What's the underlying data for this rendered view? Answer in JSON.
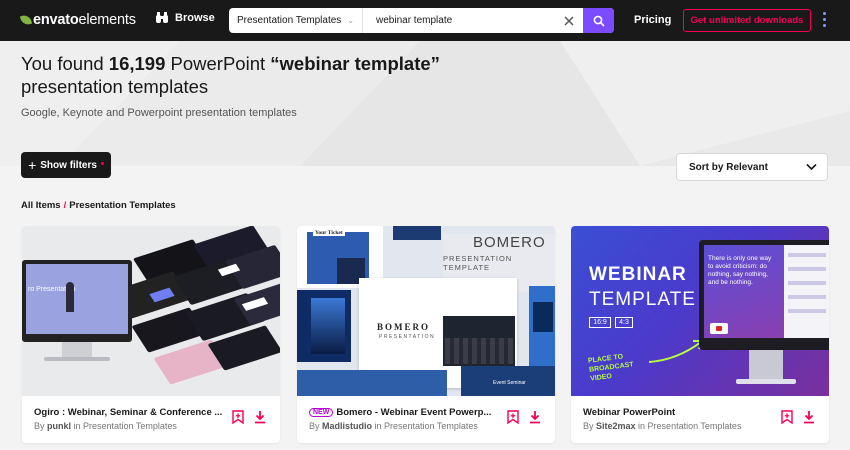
{
  "nav": {
    "logo_bold": "envato",
    "logo_light": "elements",
    "browse_label": "Browse",
    "search_category": "Presentation Templates",
    "search_value": "webinar template",
    "pricing_label": "Pricing",
    "cta_label": "Get unlimited downloads",
    "colors": {
      "bar": "#191919",
      "search_button": "#7b4bff",
      "cta": "#f50057",
      "logo_leaf": "#82b541"
    }
  },
  "hero": {
    "prefix": "You found ",
    "count": "16,199",
    "middle": " PowerPoint ",
    "query": "“webinar template”",
    "suffix": "presentation templates",
    "subtitle": "Google, Keynote and Powerpoint presentation templates"
  },
  "filters": {
    "show_filters_label": "Show filters",
    "sort_label": "Sort by Relevant"
  },
  "breadcrumb": {
    "root": "All Items",
    "separator": "/",
    "current": "Presentation Templates"
  },
  "cards": [
    {
      "title": "Ogiro : Webinar, Seminar & Conference ...",
      "by_prefix": "By ",
      "author": "punkl",
      "in_text": " in Presentation Templates",
      "is_new": false,
      "thumb_text": "ro Presentation"
    },
    {
      "title": "Bomero - Webinar Event Powerp...",
      "by_prefix": "By ",
      "author": "Madlistudio",
      "in_text": " in Presentation Templates",
      "is_new": true,
      "new_label": "NEW",
      "thumb_title": "BOMERO",
      "thumb_subtitle": "PRESENTATION TEMPLATE",
      "thumb_ticket": "Your Ticket",
      "thumb_logo": "BOMERO",
      "thumb_logo_sub": "PRESENTATION",
      "thumb_event": "Event Seminar"
    },
    {
      "title": "Webinar PowerPoint",
      "by_prefix": "By ",
      "author": "Site2max",
      "in_text": " in Presentation Templates",
      "is_new": false,
      "thumb_line1": "WEBINAR",
      "thumb_line2": "TEMPLATE",
      "thumb_tag1": "16:9",
      "thumb_tag2": "4:3",
      "thumb_callout": "PLACE TO\nBROADCAST\nVIDEO",
      "thumb_quote": "There is only one way to avoid criticism: do nothing, say nothing, and be nothing."
    }
  ]
}
